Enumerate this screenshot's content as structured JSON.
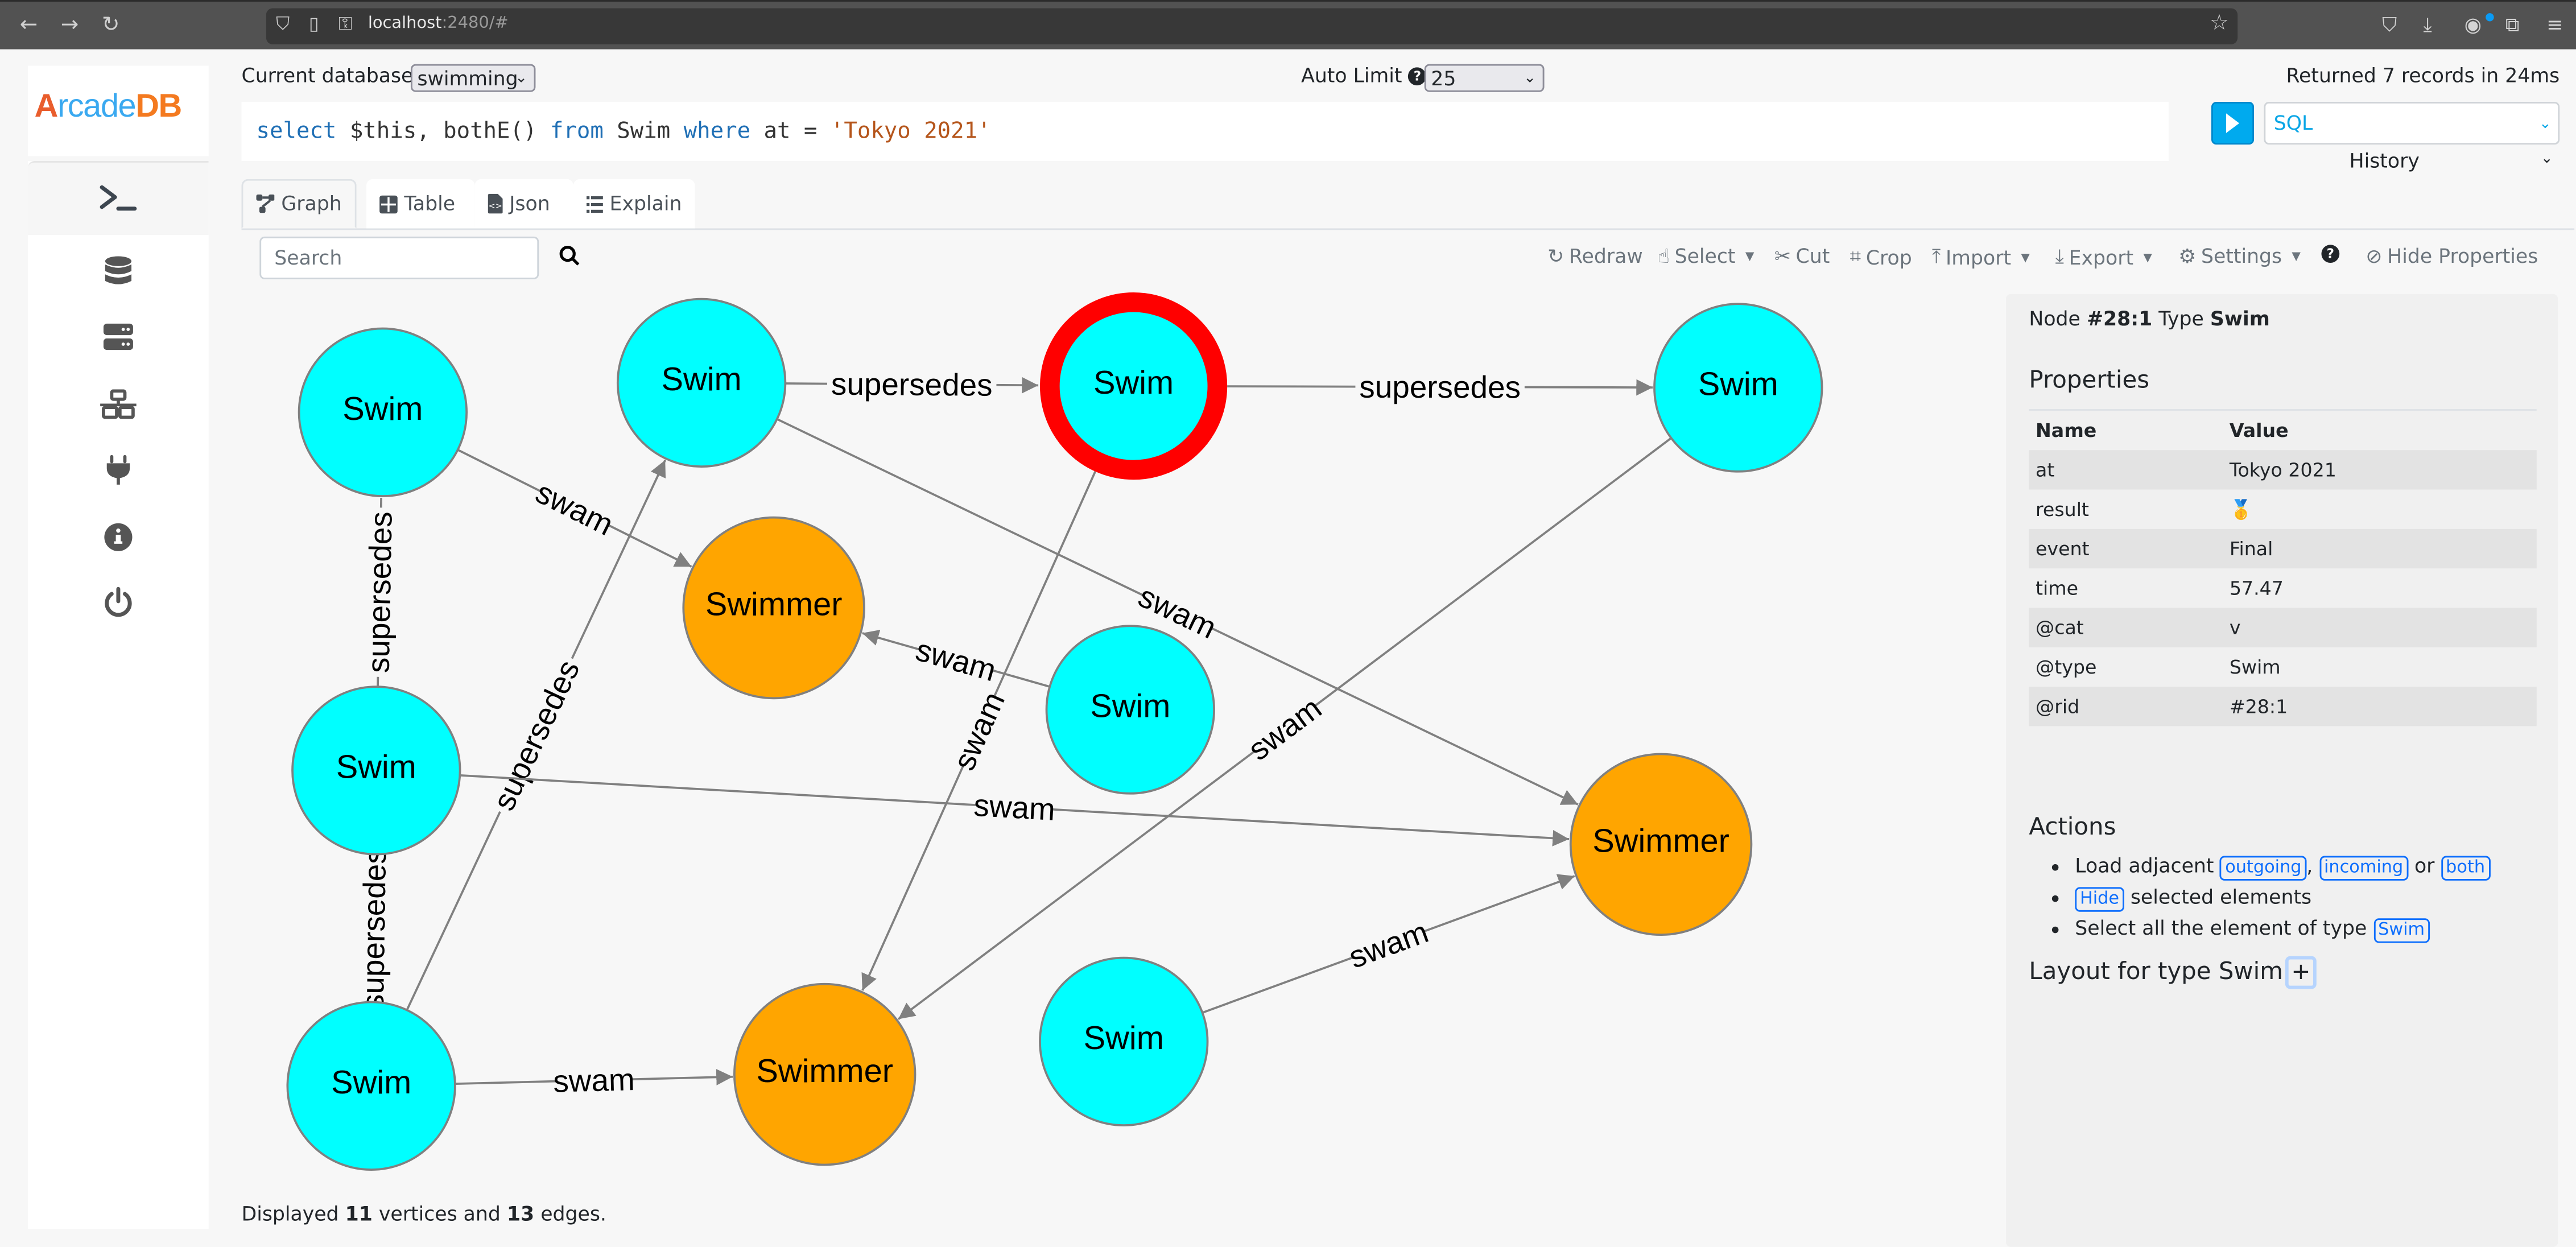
{
  "browser": {
    "url_host": "localhost",
    "url_rest": ":2480/#"
  },
  "app": {
    "logo_prefix": "A",
    "logo_mid": "rcade",
    "logo_suffix": "DB",
    "current_db_label": "Current database:",
    "current_db_value": "swimming",
    "auto_limit_label": "Auto Limit",
    "auto_limit_value": "25",
    "status": "Returned 7 records in 24ms",
    "language": "SQL",
    "history_label": "History"
  },
  "query": {
    "parts": [
      {
        "t": "select",
        "c": "kw"
      },
      {
        "t": " $this, bothE() ",
        "c": ""
      },
      {
        "t": "from",
        "c": "kw"
      },
      {
        "t": " Swim ",
        "c": ""
      },
      {
        "t": "where",
        "c": "kw"
      },
      {
        "t": " at = ",
        "c": ""
      },
      {
        "t": "'Tokyo 2021'",
        "c": "str"
      }
    ]
  },
  "sidebar": {
    "items": [
      {
        "name": "query",
        "icon": "terminal-icon"
      },
      {
        "name": "database",
        "icon": "database-icon"
      },
      {
        "name": "server",
        "icon": "server-icon"
      },
      {
        "name": "cluster",
        "icon": "network-icon"
      },
      {
        "name": "api",
        "icon": "plug-icon"
      },
      {
        "name": "info",
        "icon": "info-icon"
      },
      {
        "name": "logout",
        "icon": "power-icon"
      }
    ]
  },
  "tabs": [
    {
      "label": "Graph",
      "icon": "graph-icon",
      "active": true
    },
    {
      "label": "Table",
      "icon": "table-icon",
      "active": false
    },
    {
      "label": "Json",
      "icon": "json-file-icon",
      "active": false
    },
    {
      "label": "Explain",
      "icon": "list-icon",
      "active": false
    }
  ],
  "search": {
    "placeholder": "Search"
  },
  "toolbar": {
    "redraw": "Redraw",
    "select": "Select",
    "cut": "Cut",
    "crop": "Crop",
    "import": "Import",
    "export": "Export",
    "settings": "Settings",
    "hide_properties": "Hide Properties"
  },
  "graph": {
    "colors": {
      "Swim": "#00ffff",
      "Swimmer": "#ffa500",
      "selected": "#ff0000"
    },
    "nodes": [
      {
        "id": "n1",
        "type": "Swim",
        "label": "Swim"
      },
      {
        "id": "n2",
        "type": "Swim",
        "label": "Swim"
      },
      {
        "id": "n3",
        "type": "Swim",
        "label": "Swim",
        "selected": true
      },
      {
        "id": "n4",
        "type": "Swim",
        "label": "Swim"
      },
      {
        "id": "n5",
        "type": "Swimmer",
        "label": "Swimmer"
      },
      {
        "id": "n6",
        "type": "Swim",
        "label": "Swim"
      },
      {
        "id": "n7",
        "type": "Swim",
        "label": "Swim"
      },
      {
        "id": "n8",
        "type": "Swimmer",
        "label": "Swimmer"
      },
      {
        "id": "n9",
        "type": "Swim",
        "label": "Swim"
      },
      {
        "id": "n10",
        "type": "Swimmer",
        "label": "Swimmer"
      },
      {
        "id": "n11",
        "type": "Swim",
        "label": "Swim"
      }
    ],
    "edges": [
      {
        "from": "n2",
        "to": "n3",
        "label": "supersedes"
      },
      {
        "from": "n3",
        "to": "n4",
        "label": "supersedes"
      },
      {
        "from": "n1",
        "to": "n5",
        "label": "swam"
      },
      {
        "from": "n7",
        "to": "n1",
        "label": "supersedes",
        "arrow": false
      },
      {
        "from": "n9",
        "to": "n7",
        "label": "supersedes",
        "arrow": false
      },
      {
        "from": "n9",
        "to": "n2",
        "label": "supersedes"
      },
      {
        "from": "n2",
        "to": "n8",
        "label": "swam"
      },
      {
        "from": "n6",
        "to": "n5",
        "label": "swam"
      },
      {
        "from": "n3",
        "to": "n10",
        "label": "swam"
      },
      {
        "from": "n4",
        "to": "n10",
        "label": "swam"
      },
      {
        "from": "n7",
        "to": "n8",
        "label": "swam"
      },
      {
        "from": "n9",
        "to": "n10",
        "label": "swam"
      },
      {
        "from": "n11",
        "to": "n8",
        "label": "swam"
      }
    ]
  },
  "properties": {
    "node_prefix": "Node",
    "node_rid": "#28:1",
    "type_prefix": "Type",
    "node_type": "Swim",
    "title": "Properties",
    "col_name": "Name",
    "col_value": "Value",
    "rows": [
      {
        "name": "at",
        "value": "Tokyo 2021"
      },
      {
        "name": "result",
        "value": "🥇"
      },
      {
        "name": "event",
        "value": "Final"
      },
      {
        "name": "time",
        "value": "57.47"
      },
      {
        "name": "@cat",
        "value": "v"
      },
      {
        "name": "@type",
        "value": "Swim"
      },
      {
        "name": "@rid",
        "value": "#28:1"
      }
    ]
  },
  "actions": {
    "title": "Actions",
    "load_text": "Load adjacent",
    "outgoing": "outgoing",
    "incoming": "incoming",
    "or_text": "or",
    "both": "both",
    "hide": "Hide",
    "hide_text": "selected elements",
    "select_text": "Select all the element of type",
    "select_type": "Swim",
    "layout_title": "Layout for type Swim",
    "layout_add": "+"
  },
  "footer": {
    "prefix": "Displayed",
    "vertices": "11",
    "mid": "vertices and",
    "edges": "13",
    "suffix": "edges."
  }
}
